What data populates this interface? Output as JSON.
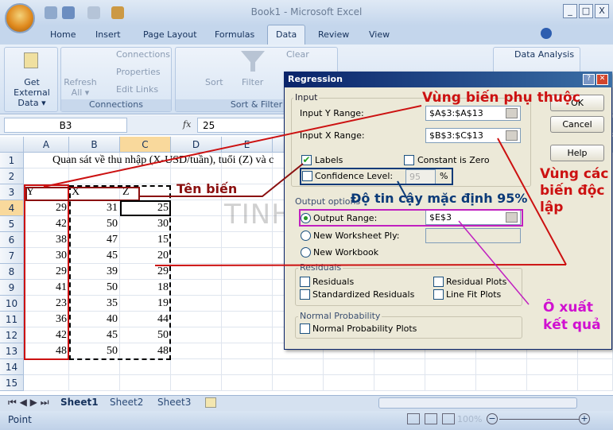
{
  "window": {
    "title": "Book1 - Microsoft Excel",
    "min": "_",
    "max": "□",
    "close": "X"
  },
  "tabs": [
    {
      "label": "Home"
    },
    {
      "label": "Insert"
    },
    {
      "label": "Page Layout"
    },
    {
      "label": "Formulas"
    },
    {
      "label": "Data"
    },
    {
      "label": "Review"
    },
    {
      "label": "View"
    }
  ],
  "active_tab": "Data",
  "ribbon": {
    "get_external_data": "Get External Data ▾",
    "refresh": "Refresh All ▾",
    "connections": "Connections",
    "properties": "Properties",
    "edit_links": "Edit Links",
    "group_connections": "Connections",
    "sort": "Sort",
    "filter": "Filter",
    "clear": "Clear",
    "group_sort_filter": "Sort & Filter",
    "data_analysis": "Data Analysis"
  },
  "formula_bar": {
    "name_box": "B3",
    "fx": "fx",
    "value": "25"
  },
  "sheet": {
    "columns": [
      "A",
      "B",
      "C",
      "D",
      "E"
    ],
    "rows": [
      "1",
      "2",
      "3",
      "4",
      "5",
      "6",
      "7",
      "8",
      "9",
      "10",
      "11",
      "12",
      "13",
      "14",
      "15"
    ],
    "row1_text": "Quan sát về thu nhập (X-USD/tuần), tuổi (Z) và c",
    "headers": [
      "Y",
      "X",
      "Z"
    ],
    "data": [
      [
        29,
        31,
        25
      ],
      [
        42,
        50,
        30
      ],
      [
        38,
        47,
        15
      ],
      [
        30,
        45,
        20
      ],
      [
        29,
        39,
        29
      ],
      [
        41,
        50,
        18
      ],
      [
        23,
        35,
        19
      ],
      [
        36,
        40,
        44
      ],
      [
        42,
        45,
        50
      ],
      [
        48,
        50,
        48
      ]
    ]
  },
  "sheet_tabs": [
    "Sheet1",
    "Sheet2",
    "Sheet3"
  ],
  "status": {
    "mode": "Point",
    "zoom": "100%"
  },
  "dialog": {
    "title": "Regression",
    "input_group": "Input",
    "input_y_label": "Input Y Range:",
    "input_y_value": "$A$3:$A$13",
    "input_x_label": "Input X Range:",
    "input_x_value": "$B$3:$C$13",
    "labels": "Labels",
    "labels_checked": true,
    "constant_zero": "Constant is Zero",
    "confidence": "Confidence Level:",
    "confidence_value": "95",
    "percent": "%",
    "output_group": "Output options",
    "output_range": "Output Range:",
    "output_range_value": "$E$3",
    "new_ply": "New Worksheet Ply:",
    "new_workbook": "New Workbook",
    "residuals_group": "Residuals",
    "residuals": "Residuals",
    "std_residuals": "Standardized Residuals",
    "residual_plots": "Residual Plots",
    "line_fit": "Line Fit Plots",
    "normal_group": "Normal Probability",
    "normal_plots": "Normal Probability Plots",
    "ok": "OK",
    "cancel": "Cancel",
    "help": "Help"
  },
  "annotations": {
    "dependent": "Vùng biến phụ thuộc",
    "independent": "Vùng các biến độc lập",
    "var_names": "Tên biến",
    "confidence_default": "Độ tin cậy mặc định 95%",
    "output_cell": "Ô xuất kết quả",
    "watermark": "TINHOCMOS"
  },
  "colors": {
    "red": "#cc1111",
    "dark_red": "#8b1010",
    "blue": "#0b3a78",
    "magenta": "#d010d0"
  }
}
